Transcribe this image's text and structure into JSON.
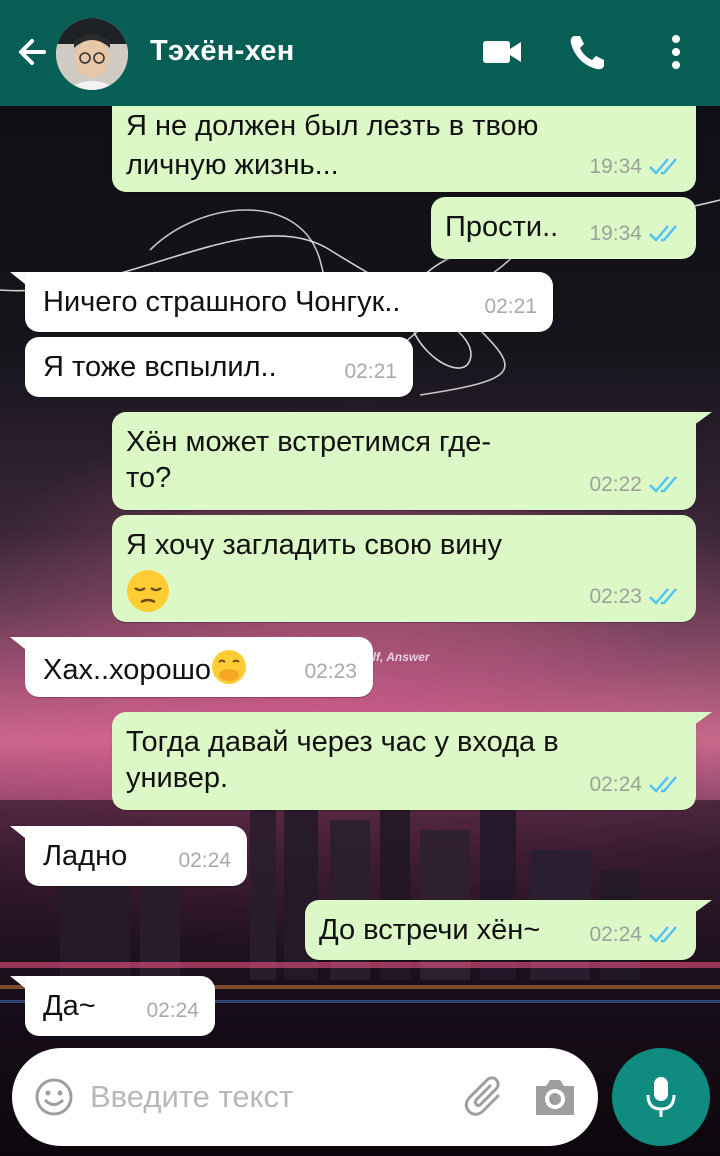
{
  "header": {
    "contact_name": "Тэхён-хен",
    "icons": [
      "back-arrow-icon",
      "video-call-icon",
      "voice-call-icon",
      "more-options-icon"
    ]
  },
  "wallpaper": {
    "watermark": "elf, Answer"
  },
  "messages": [
    {
      "dir": "out",
      "lines": [
        "Я не должен был лезть в твою",
        "личную жизнь..."
      ],
      "time": "19:34",
      "status": "read"
    },
    {
      "dir": "out",
      "lines": [
        "Прости.."
      ],
      "time": "19:34",
      "status": "read"
    },
    {
      "dir": "in",
      "lines": [
        "Ничего страшного Чонгук.."
      ],
      "time": "02:21"
    },
    {
      "dir": "in",
      "lines": [
        "Я тоже вспылил.."
      ],
      "time": "02:21"
    },
    {
      "dir": "out",
      "lines": [
        "Хён может встретимся где-",
        "то?"
      ],
      "time": "02:22",
      "status": "read"
    },
    {
      "dir": "out",
      "lines": [
        "Я хочу загладить свою вину"
      ],
      "emoji": "pensive-face",
      "time": "02:23",
      "status": "read"
    },
    {
      "dir": "in",
      "lines": [
        "Хах..хорошо"
      ],
      "emoji": "face-with-hand-over-mouth",
      "time": "02:23"
    },
    {
      "dir": "out",
      "lines": [
        "Тогда давай через час у входа в",
        "универ."
      ],
      "time": "02:24",
      "status": "read"
    },
    {
      "dir": "in",
      "lines": [
        "Ладно"
      ],
      "time": "02:24"
    },
    {
      "dir": "out",
      "lines": [
        "До встречи хён~"
      ],
      "time": "02:24",
      "status": "read"
    },
    {
      "dir": "in",
      "lines": [
        "Да~"
      ],
      "time": "02:24"
    }
  ],
  "composer": {
    "placeholder": "Введите текст",
    "icons": [
      "emoji-icon",
      "attach-icon",
      "camera-icon",
      "mic-icon"
    ]
  },
  "colors": {
    "appbar": "#075e54",
    "outgoing_bubble": "#dcf8c6",
    "incoming_bubble": "#ffffff",
    "read_ticks": "#4fc3f7",
    "mic_button": "#0f8b80"
  }
}
